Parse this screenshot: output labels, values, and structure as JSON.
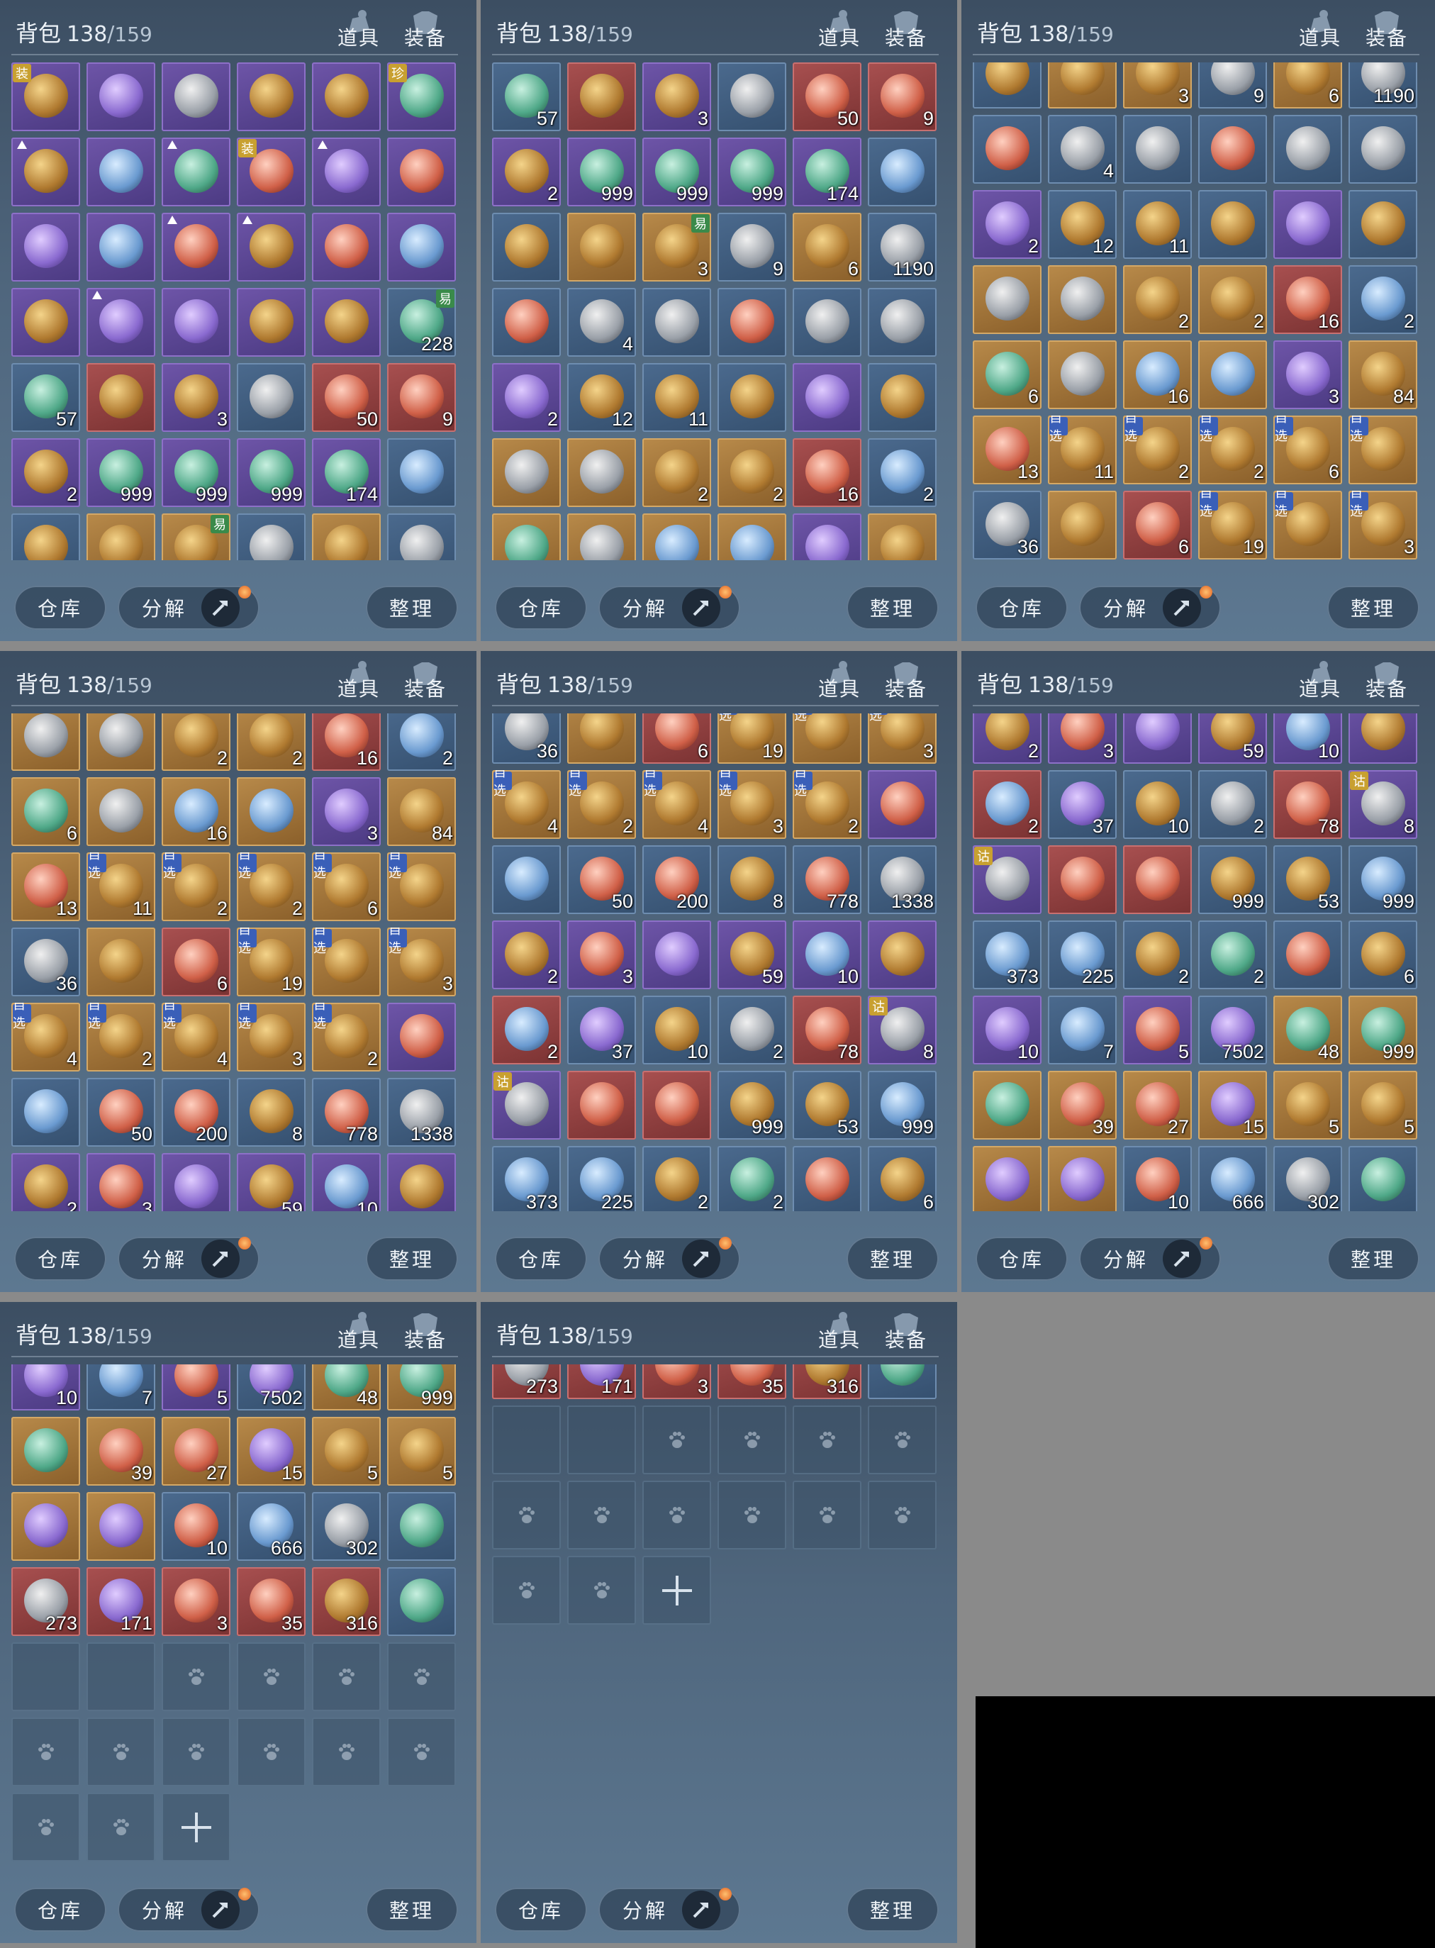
{
  "header": {
    "title_label": "背包",
    "count_used": "138",
    "count_sep": "/",
    "count_cap": "159",
    "tab_items": "道具",
    "tab_equip": "装备"
  },
  "footer": {
    "warehouse_label": "仓库",
    "dismantle_label": "分解",
    "sort_label": "整理"
  },
  "colors": {
    "purple_slot": "#6e55a8",
    "gold_slot": "#b88a4a",
    "blue_slot": "#4b6a8e",
    "red_slot": "#a85050",
    "green_slot": "#4f8a72",
    "text": "#f0f4f8"
  },
  "icons": {
    "tab_items": "bag-icon",
    "tab_equip": "armor-icon",
    "dismantle_toggle": "hammer-icon",
    "empty_locked": "paw-icon",
    "add_slot": "plus-icon"
  },
  "items": [
    {
      "c": "purple",
      "q": "",
      "b": "装",
      "a": 0
    },
    {
      "c": "purple",
      "q": "",
      "a": 1
    },
    {
      "c": "purple",
      "q": "",
      "a": 5
    },
    {
      "c": "purple",
      "q": "",
      "a": 0
    },
    {
      "c": "purple",
      "q": "",
      "a": 0
    },
    {
      "c": "purple",
      "q": "",
      "b": "珍",
      "a": 2
    },
    {
      "c": "purple",
      "q": "",
      "up": true,
      "a": 0
    },
    {
      "c": "purple",
      "q": "",
      "a": 4
    },
    {
      "c": "purple",
      "q": "",
      "up": true,
      "a": 2
    },
    {
      "c": "purple",
      "q": "",
      "b": "装",
      "a": 3
    },
    {
      "c": "purple",
      "q": "",
      "up": true,
      "a": 1
    },
    {
      "c": "purple",
      "q": "",
      "a": 3
    },
    {
      "c": "purple",
      "q": "",
      "a": 1
    },
    {
      "c": "purple",
      "q": "",
      "a": 4
    },
    {
      "c": "purple",
      "q": "",
      "up": true,
      "a": 3
    },
    {
      "c": "purple",
      "q": "",
      "up": true,
      "a": 0
    },
    {
      "c": "purple",
      "q": "",
      "a": 3
    },
    {
      "c": "purple",
      "q": "",
      "a": 4
    },
    {
      "c": "purple",
      "q": "",
      "a": 0
    },
    {
      "c": "purple",
      "q": "",
      "up": true,
      "a": 1
    },
    {
      "c": "purple",
      "q": "",
      "a": 1
    },
    {
      "c": "purple",
      "q": "",
      "a": 0
    },
    {
      "c": "purple",
      "q": "",
      "a": 0
    },
    {
      "c": "blue",
      "q": "228",
      "g": "易",
      "a": 2
    },
    {
      "c": "blue",
      "q": "57",
      "a": 2
    },
    {
      "c": "red",
      "q": "",
      "a": 0
    },
    {
      "c": "purple",
      "q": "3",
      "a": 0
    },
    {
      "c": "blue",
      "q": "",
      "a": 5
    },
    {
      "c": "red",
      "q": "50",
      "a": 3
    },
    {
      "c": "red",
      "q": "9",
      "a": 3
    },
    {
      "c": "purple",
      "q": "2",
      "a": 0
    },
    {
      "c": "purple",
      "q": "999",
      "a": 2
    },
    {
      "c": "purple",
      "q": "999",
      "a": 2
    },
    {
      "c": "purple",
      "q": "999",
      "a": 2
    },
    {
      "c": "purple",
      "q": "174",
      "a": 2
    },
    {
      "c": "blue",
      "q": "",
      "a": 4
    },
    {
      "c": "blue",
      "q": "",
      "a": 0
    },
    {
      "c": "gold",
      "q": "",
      "a": 0
    },
    {
      "c": "gold",
      "q": "3",
      "g": "易",
      "a": 0
    },
    {
      "c": "blue",
      "q": "9",
      "a": 5
    },
    {
      "c": "gold",
      "q": "6",
      "a": 0
    },
    {
      "c": "blue",
      "q": "1190",
      "a": 5
    },
    {
      "c": "blue",
      "q": "",
      "a": 3
    },
    {
      "c": "blue",
      "q": "4",
      "a": 5
    },
    {
      "c": "blue",
      "q": "",
      "a": 5
    },
    {
      "c": "blue",
      "q": "",
      "a": 3
    },
    {
      "c": "blue",
      "q": "",
      "a": 5
    },
    {
      "c": "blue",
      "q": "",
      "a": 5
    },
    {
      "c": "purple",
      "q": "2",
      "a": 1
    },
    {
      "c": "blue",
      "q": "12",
      "a": 0
    },
    {
      "c": "blue",
      "q": "11",
      "a": 0
    },
    {
      "c": "blue",
      "q": "",
      "a": 0
    },
    {
      "c": "purple",
      "q": "",
      "a": 1
    },
    {
      "c": "blue",
      "q": "",
      "a": 0
    },
    {
      "c": "gold",
      "q": "",
      "a": 5
    },
    {
      "c": "gold",
      "q": "",
      "a": 5
    },
    {
      "c": "gold",
      "q": "2",
      "a": 0
    },
    {
      "c": "gold",
      "q": "2",
      "a": 0
    },
    {
      "c": "red",
      "q": "16",
      "a": 3
    },
    {
      "c": "blue",
      "q": "2",
      "a": 4
    },
    {
      "c": "gold",
      "q": "6",
      "a": 2
    },
    {
      "c": "gold",
      "q": "",
      "a": 5
    },
    {
      "c": "gold",
      "q": "16",
      "a": 4
    },
    {
      "c": "gold",
      "q": "",
      "a": 4
    },
    {
      "c": "purple",
      "q": "3",
      "a": 1
    },
    {
      "c": "gold",
      "q": "84",
      "a": 0
    },
    {
      "c": "gold",
      "q": "13",
      "a": 3
    },
    {
      "c": "gold",
      "q": "11",
      "b": "自选",
      "bb": true,
      "a": 0
    },
    {
      "c": "gold",
      "q": "2",
      "b": "自选",
      "bb": true,
      "a": 0
    },
    {
      "c": "gold",
      "q": "2",
      "b": "自选",
      "bb": true,
      "a": 0
    },
    {
      "c": "gold",
      "q": "6",
      "b": "自选",
      "bb": true,
      "a": 0
    },
    {
      "c": "gold",
      "q": "",
      "b": "自选",
      "bb": true,
      "a": 0
    },
    {
      "c": "blue",
      "q": "36",
      "a": 5
    },
    {
      "c": "gold",
      "q": "",
      "a": 0
    },
    {
      "c": "red",
      "q": "6",
      "a": 3
    },
    {
      "c": "gold",
      "q": "19",
      "b": "自选",
      "bb": true,
      "a": 0
    },
    {
      "c": "gold",
      "q": "",
      "b": "自选",
      "bb": true,
      "a": 0
    },
    {
      "c": "gold",
      "q": "3",
      "b": "自选",
      "bb": true,
      "a": 0
    },
    {
      "c": "gold",
      "q": "4",
      "b": "自选",
      "bb": true,
      "a": 0
    },
    {
      "c": "gold",
      "q": "2",
      "b": "自选",
      "bb": true,
      "a": 0
    },
    {
      "c": "gold",
      "q": "4",
      "b": "自选",
      "bb": true,
      "a": 0
    },
    {
      "c": "gold",
      "q": "3",
      "b": "自选",
      "bb": true,
      "a": 0
    },
    {
      "c": "gold",
      "q": "2",
      "b": "自选",
      "bb": true,
      "a": 0
    },
    {
      "c": "purple",
      "q": "",
      "a": 3
    },
    {
      "c": "blue",
      "q": "",
      "a": 4
    },
    {
      "c": "blue",
      "q": "50",
      "a": 3
    },
    {
      "c": "blue",
      "q": "200",
      "a": 3
    },
    {
      "c": "blue",
      "q": "8",
      "a": 0
    },
    {
      "c": "blue",
      "q": "778",
      "a": 3
    },
    {
      "c": "blue",
      "q": "1338",
      "a": 5
    },
    {
      "c": "purple",
      "q": "2",
      "a": 0
    },
    {
      "c": "purple",
      "q": "3",
      "a": 3
    },
    {
      "c": "purple",
      "q": "",
      "a": 1
    },
    {
      "c": "purple",
      "q": "59",
      "a": 0
    },
    {
      "c": "purple",
      "q": "10",
      "a": 4
    },
    {
      "c": "purple",
      "q": "",
      "a": 0
    },
    {
      "c": "red",
      "q": "2",
      "a": 4
    },
    {
      "c": "blue",
      "q": "37",
      "a": 1
    },
    {
      "c": "blue",
      "q": "10",
      "a": 0
    },
    {
      "c": "blue",
      "q": "2",
      "a": 5
    },
    {
      "c": "red",
      "q": "78",
      "a": 3
    },
    {
      "c": "purple",
      "q": "8",
      "b": "诂",
      "a": 5
    },
    {
      "c": "purple",
      "q": "",
      "b": "诂",
      "a": 5
    },
    {
      "c": "red",
      "q": "",
      "a": 3
    },
    {
      "c": "red",
      "q": "",
      "a": 3
    },
    {
      "c": "blue",
      "q": "999",
      "a": 0
    },
    {
      "c": "blue",
      "q": "53",
      "a": 0
    },
    {
      "c": "blue",
      "q": "999",
      "a": 4
    },
    {
      "c": "blue",
      "q": "373",
      "a": 4
    },
    {
      "c": "blue",
      "q": "225",
      "a": 4
    },
    {
      "c": "blue",
      "q": "2",
      "a": 0
    },
    {
      "c": "blue",
      "q": "2",
      "a": 2
    },
    {
      "c": "blue",
      "q": "",
      "a": 3
    },
    {
      "c": "blue",
      "q": "6",
      "a": 0
    },
    {
      "c": "purple",
      "q": "10",
      "a": 1
    },
    {
      "c": "blue",
      "q": "7",
      "a": 4
    },
    {
      "c": "purple",
      "q": "5",
      "a": 3
    },
    {
      "c": "blue",
      "q": "7502",
      "a": 1
    },
    {
      "c": "gold",
      "q": "48",
      "a": 2
    },
    {
      "c": "gold",
      "q": "999",
      "a": 2
    },
    {
      "c": "gold",
      "q": "",
      "a": 2
    },
    {
      "c": "gold",
      "q": "39",
      "a": 3
    },
    {
      "c": "gold",
      "q": "27",
      "a": 3
    },
    {
      "c": "gold",
      "q": "15",
      "a": 1
    },
    {
      "c": "gold",
      "q": "5",
      "a": 0
    },
    {
      "c": "gold",
      "q": "5",
      "a": 0
    },
    {
      "c": "gold",
      "q": "",
      "a": 1
    },
    {
      "c": "gold",
      "q": "",
      "a": 1
    },
    {
      "c": "blue",
      "q": "10",
      "a": 3
    },
    {
      "c": "blue",
      "q": "666",
      "a": 4
    },
    {
      "c": "blue",
      "q": "302",
      "a": 5
    },
    {
      "c": "blue",
      "q": "",
      "a": 2
    },
    {
      "c": "red",
      "q": "273",
      "a": 5
    },
    {
      "c": "red",
      "q": "171",
      "a": 1
    },
    {
      "c": "red",
      "q": "3",
      "a": 3
    },
    {
      "c": "red",
      "q": "35",
      "a": 3
    },
    {
      "c": "red",
      "q": "316",
      "a": 0
    },
    {
      "c": "blue",
      "q": "",
      "a": 2
    }
  ]
}
